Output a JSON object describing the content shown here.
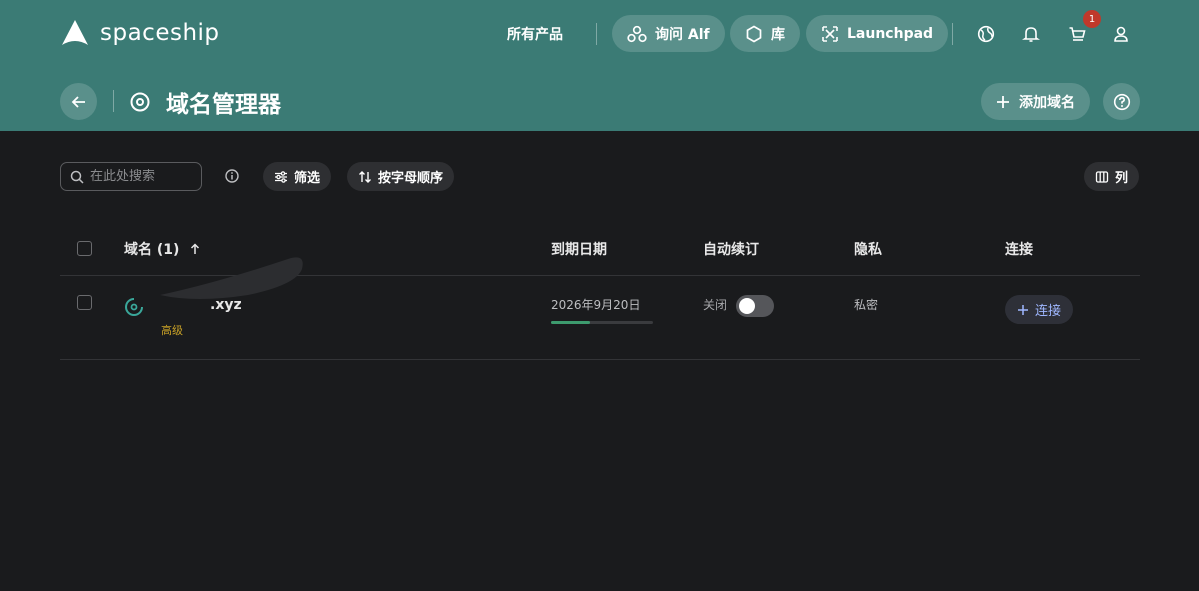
{
  "header": {
    "logo_text": "spaceship",
    "all_products": "所有产品",
    "ask_alf": "询问 Alf",
    "library": "库",
    "launchpad": "Launchpad",
    "cart_count": "1",
    "page_title": "域名管理器",
    "add_domain": "添加域名",
    "colors": {
      "background": "#3b7b75",
      "badge": "#c0392b"
    }
  },
  "toolbar": {
    "search_placeholder": "在此处搜索",
    "filter": "筛选",
    "sort": "按字母顺序",
    "columns": "列"
  },
  "table": {
    "columns": {
      "domain": "域名 (1)",
      "expiry": "到期日期",
      "auto_renew": "自动续订",
      "privacy": "隐私",
      "connect": "连接"
    },
    "rows": [
      {
        "domain_visible": ".xyz",
        "tier": "高级",
        "expiry": "2026年9月20日",
        "expiry_progress": 0.38,
        "auto_renew_label": "关闭",
        "auto_renew_on": false,
        "privacy": "私密",
        "connect": "连接"
      }
    ]
  }
}
